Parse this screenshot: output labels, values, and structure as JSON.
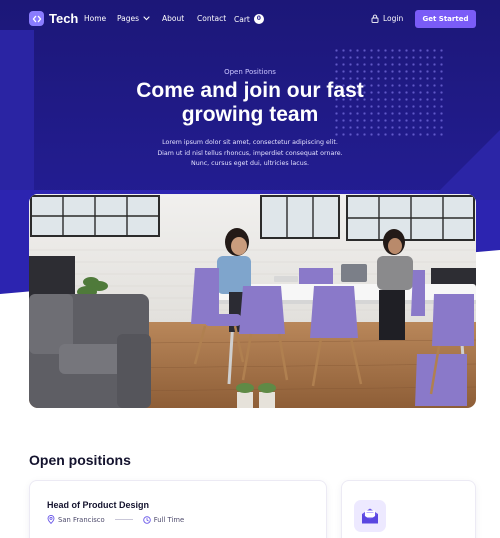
{
  "brand": {
    "name": "Tech",
    "accent": "#7a5cf7",
    "hero_bg": "#221c8e"
  },
  "nav": {
    "links": [
      "Home",
      "Pages",
      "About",
      "Contact",
      "Cart"
    ],
    "cart_count": "0",
    "login": "Login",
    "cta": "Get Started"
  },
  "hero": {
    "eyebrow": "Open Positions",
    "title_line1": "Come and join our fast",
    "title_line2": "growing team",
    "sub_line1": "Lorem ipsum dolor sit amet, consectetur adipiscing elit.",
    "sub_line2": "Diam ut id nisl tellus rhoncus, imperdiet consequat ornare.",
    "sub_line3": "Nunc, cursus eget dui, ultricies lacus."
  },
  "positions": {
    "title": "Open positions",
    "jobs": [
      {
        "title": "Head of Product Design",
        "location": "San Francisco",
        "type": "Full Time"
      }
    ]
  },
  "icons": {
    "logo": "code-brackets-icon",
    "pages_caret": "chevron-down-icon",
    "login": "lock-icon",
    "location": "map-pin-icon",
    "type": "clock-icon",
    "mail": "envelope-open-icon"
  }
}
